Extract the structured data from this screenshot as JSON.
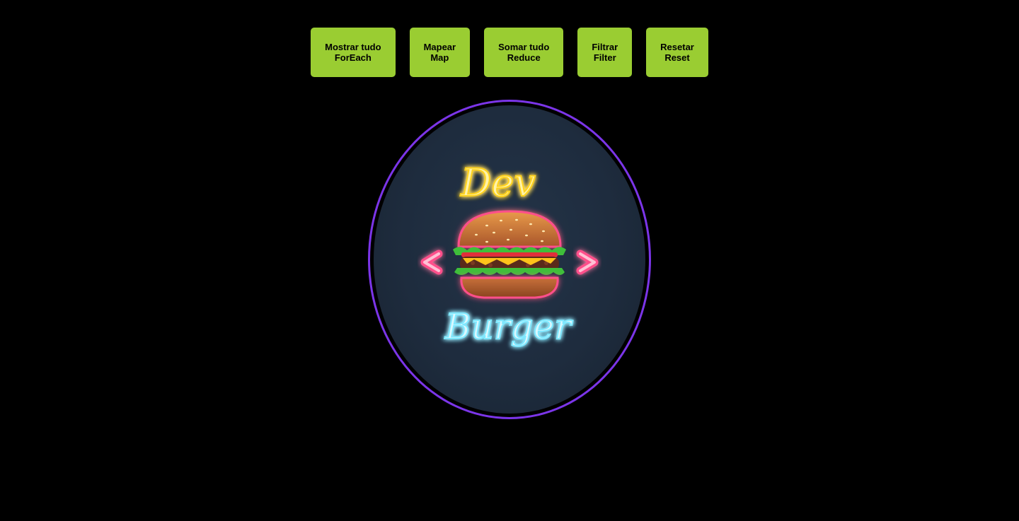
{
  "buttons": [
    {
      "line1": "Mostrar tudo",
      "line2": "ForEach"
    },
    {
      "line1": "Mapear",
      "line2": "Map"
    },
    {
      "line1": "Somar tudo",
      "line2": "Reduce"
    },
    {
      "line1": "Filtrar",
      "line2": "Filter"
    },
    {
      "line1": "Resetar",
      "line2": "Reset"
    }
  ],
  "logo": {
    "word_top": "Dev",
    "word_bottom": "Burger",
    "colors": {
      "ring": "#7b35e8",
      "background": "#1e2c3e",
      "neon_yellow": "#ffd21f",
      "neon_cyan": "#7fe8ff",
      "neon_pink": "#ff4f8b"
    }
  },
  "colors": {
    "page_background": "#000000",
    "button_background": "#9acd32",
    "button_text": "#000000"
  }
}
